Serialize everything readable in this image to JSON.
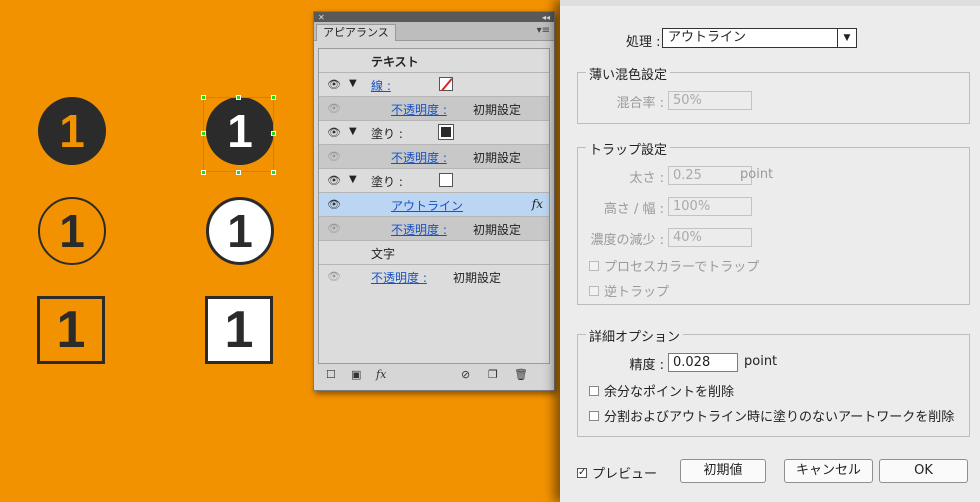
{
  "canvas": {
    "icons": [
      "1",
      "1",
      "1",
      "1",
      "1",
      "1"
    ]
  },
  "panel": {
    "tab_label": "アピアランス",
    "rows": {
      "text": "テキスト",
      "stroke": "線 :",
      "stroke_opacity_label": "不透明度 :",
      "stroke_opacity_value": "初期設定",
      "fill1": "塗り :",
      "fill1_opacity_label": "不透明度 :",
      "fill1_opacity_value": "初期設定",
      "fill2": "塗り :",
      "outline_label": "アウトライン",
      "outline_fx": "fx",
      "fill2_opacity_label": "不透明度 :",
      "fill2_opacity_value": "初期設定",
      "char": "文字",
      "char_opacity_label": "不透明度 :",
      "char_opacity_value": "初期設定"
    },
    "bottom": {
      "fx": "fx"
    }
  },
  "dialog": {
    "process_label": "処理 :",
    "process_value": "アウトライン",
    "blend": {
      "title": "薄い混色設定",
      "mix_label": "混合率 :",
      "mix_value": "50%"
    },
    "trap": {
      "title": "トラップ設定",
      "thickness_label": "太さ :",
      "thickness_value": "0.25",
      "thickness_unit": "point",
      "height_label": "高さ / 幅 :",
      "height_value": "100%",
      "tint_label": "濃度の減少 :",
      "tint_value": "40%",
      "process_trap": "プロセスカラーでトラップ",
      "reverse_trap": "逆トラップ"
    },
    "detail": {
      "title": "詳細オプション",
      "precision_label": "精度 :",
      "precision_value": "0.028",
      "precision_unit": "point",
      "remove_redundant": "余分なポイントを削除",
      "divide_outline": "分割およびアウトライン時に塗りのないアートワークを削除"
    },
    "preview": "プレビュー",
    "preview_checked": true,
    "buttons": {
      "defaults": "初期値",
      "cancel": "キャンセル",
      "ok": "OK"
    }
  },
  "colors": {
    "background": "#f39200",
    "icon_dark": "#2b2b2b",
    "selection": "#22d622",
    "link_blue": "#1652c8"
  }
}
